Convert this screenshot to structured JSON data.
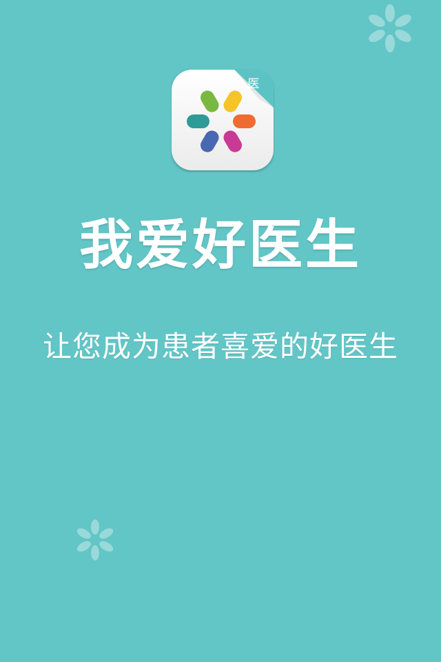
{
  "splash": {
    "app_name": "我爱好医生",
    "tagline": "让您成为患者喜爱的好医生",
    "icon_badge": "医",
    "logo_icon": "flower-petals-icon",
    "decoration_icon": "asterisk-flower-icon"
  },
  "colors": {
    "background": "#62c5c6",
    "text": "#ffffff",
    "petal_green": "#7ab842",
    "petal_yellow": "#f5c527",
    "petal_orange": "#ef6b32",
    "petal_magenta": "#c83a94",
    "petal_blue": "#4a67b1",
    "petal_teal": "#2f9b98",
    "badge_teal": "#5cc3c4"
  }
}
